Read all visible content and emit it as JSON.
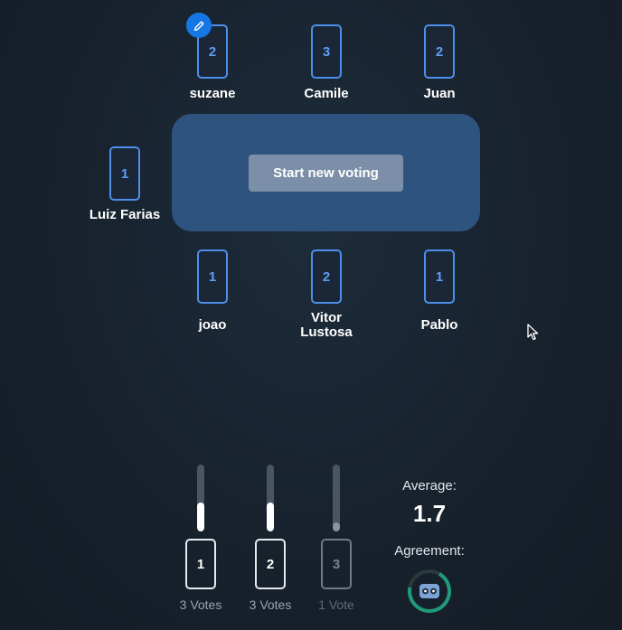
{
  "players_top": [
    {
      "name": "suzane",
      "card": "2"
    },
    {
      "name": "Camile",
      "card": "3"
    },
    {
      "name": "Juan",
      "card": "2"
    }
  ],
  "player_left": {
    "name": "Luiz Farias",
    "card": "1"
  },
  "players_bottom": [
    {
      "name": "joao",
      "card": "1"
    },
    {
      "name": "Vitor Lustosa",
      "card": "2"
    },
    {
      "name": "Pablo",
      "card": "1"
    }
  ],
  "table": {
    "button_label": "Start new voting"
  },
  "results": [
    {
      "card": "1",
      "votes": "3 Votes",
      "share": 0.43
    },
    {
      "card": "2",
      "votes": "3 Votes",
      "share": 0.43
    },
    {
      "card": "3",
      "votes": "1 Vote",
      "share": 0.14
    }
  ],
  "stats": {
    "average_label": "Average:",
    "average_value": "1.7",
    "agreement_label": "Agreement:",
    "agreement_icon": "face-icon"
  },
  "colors": {
    "accent": "#4d8fe8",
    "table": "#2f537f",
    "agreement_ring": "#1f9b79"
  },
  "icons": {
    "edit_badge": "pencil-icon",
    "cursor": "mouse-pointer-icon"
  }
}
